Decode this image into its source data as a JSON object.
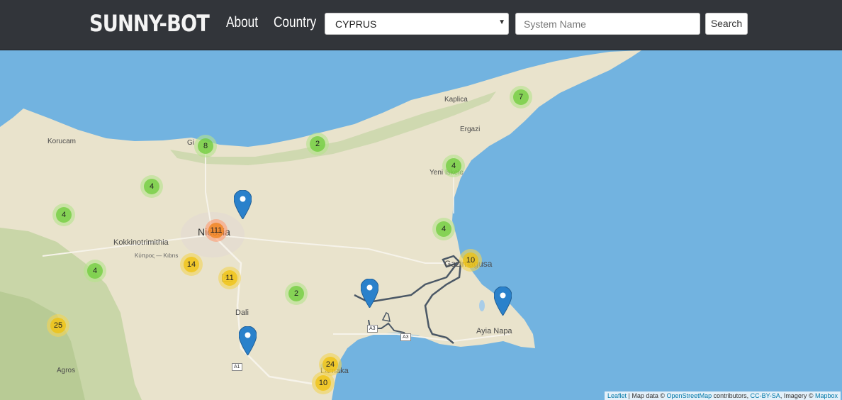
{
  "navbar": {
    "brand": "SUNNY-BOT",
    "links": [
      "About",
      "Country"
    ],
    "country_select": "CYPRUS",
    "search_placeholder": "System Name",
    "search_button": "Search"
  },
  "map": {
    "places": {
      "korucam": "Korucam",
      "kaplica": "Kaplica",
      "ergazi": "Ergazi",
      "girne": "Gi",
      "yeni_iskele": "Yeni Iskele",
      "kokkinotrimithia": "Kokkinotrimithia",
      "kypros_kibris": "Κύπρος — Kıbrıs",
      "nicosia": "Nicosia",
      "gazimagusa": "Gazimagusa",
      "dali": "Dali",
      "agros": "Agros",
      "larnaka": "Larnaka",
      "ayia_napa": "Ayia Napa"
    },
    "road_labels": [
      "A1",
      "A1",
      "A3",
      "A3"
    ],
    "clusters": [
      {
        "count": "7",
        "size": "small"
      },
      {
        "count": "8",
        "size": "small"
      },
      {
        "count": "2",
        "size": "small"
      },
      {
        "count": "4",
        "size": "small"
      },
      {
        "count": "4",
        "size": "small"
      },
      {
        "count": "4",
        "size": "small"
      },
      {
        "count": "4",
        "size": "small"
      },
      {
        "count": "111",
        "size": "large"
      },
      {
        "count": "14",
        "size": "medium"
      },
      {
        "count": "4",
        "size": "small"
      },
      {
        "count": "11",
        "size": "medium"
      },
      {
        "count": "10",
        "size": "medium"
      },
      {
        "count": "2",
        "size": "small"
      },
      {
        "count": "25",
        "size": "medium"
      },
      {
        "count": "24",
        "size": "medium"
      },
      {
        "count": "10",
        "size": "medium"
      }
    ],
    "attribution": {
      "leaflet": "Leaflet",
      "sep1": " | Map data © ",
      "osm": "OpenStreetMap",
      "sep2": " contributors, ",
      "license": "CC-BY-SA",
      "sep3": ", Imagery © ",
      "mapbox": "Mapbox"
    }
  },
  "colors": {
    "navbar_bg": "#32353a",
    "sea": "#72b3e0",
    "land": "#e9e3cc",
    "marker": "#2a81cb"
  }
}
